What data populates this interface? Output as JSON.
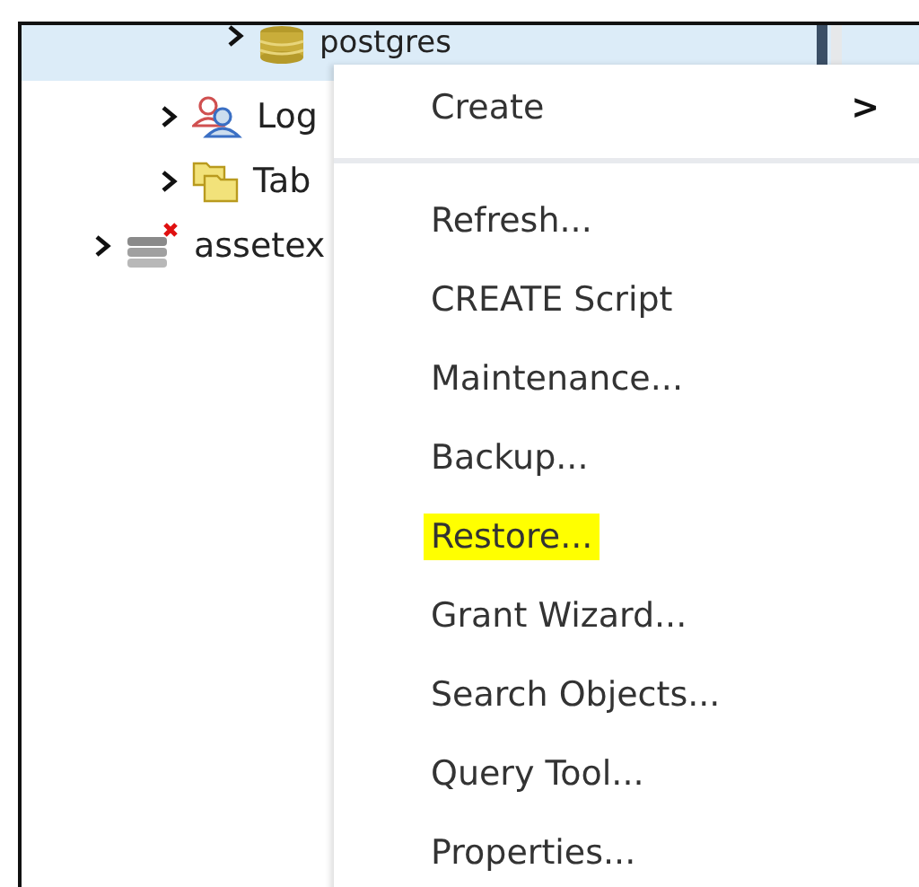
{
  "tree": [
    {
      "children": [
        {
          "children": [
            {
              "label": "postgres",
              "kind": "database",
              "selected": true
            }
          ]
        },
        {
          "label": "Log",
          "kind": "roles",
          "selected": false
        },
        {
          "label": "Tab",
          "kind": "folder",
          "selected": false
        }
      ]
    },
    {
      "label": "assetex",
      "kind": "server-error",
      "selected": false
    }
  ],
  "context_menu": {
    "items": [
      {
        "label": "Create",
        "kind": "submenu",
        "submenu_arrow": ">",
        "highlighted": false
      },
      {
        "kind": "separator"
      },
      {
        "label": "Refresh...",
        "kind": "action",
        "highlighted": false
      },
      {
        "label": "CREATE Script",
        "kind": "action",
        "highlighted": false
      },
      {
        "label": "Maintenance...",
        "kind": "action",
        "highlighted": false
      },
      {
        "label": "Backup...",
        "kind": "action",
        "highlighted": false
      },
      {
        "label": "Restore...",
        "kind": "action",
        "highlighted": true
      },
      {
        "label": "Grant Wizard...",
        "kind": "action",
        "highlighted": false
      },
      {
        "label": "Search Objects...",
        "kind": "action",
        "highlighted": false
      },
      {
        "label": "Query Tool...",
        "kind": "action",
        "highlighted": false
      },
      {
        "label": "Properties...",
        "kind": "action",
        "highlighted": false
      }
    ]
  }
}
